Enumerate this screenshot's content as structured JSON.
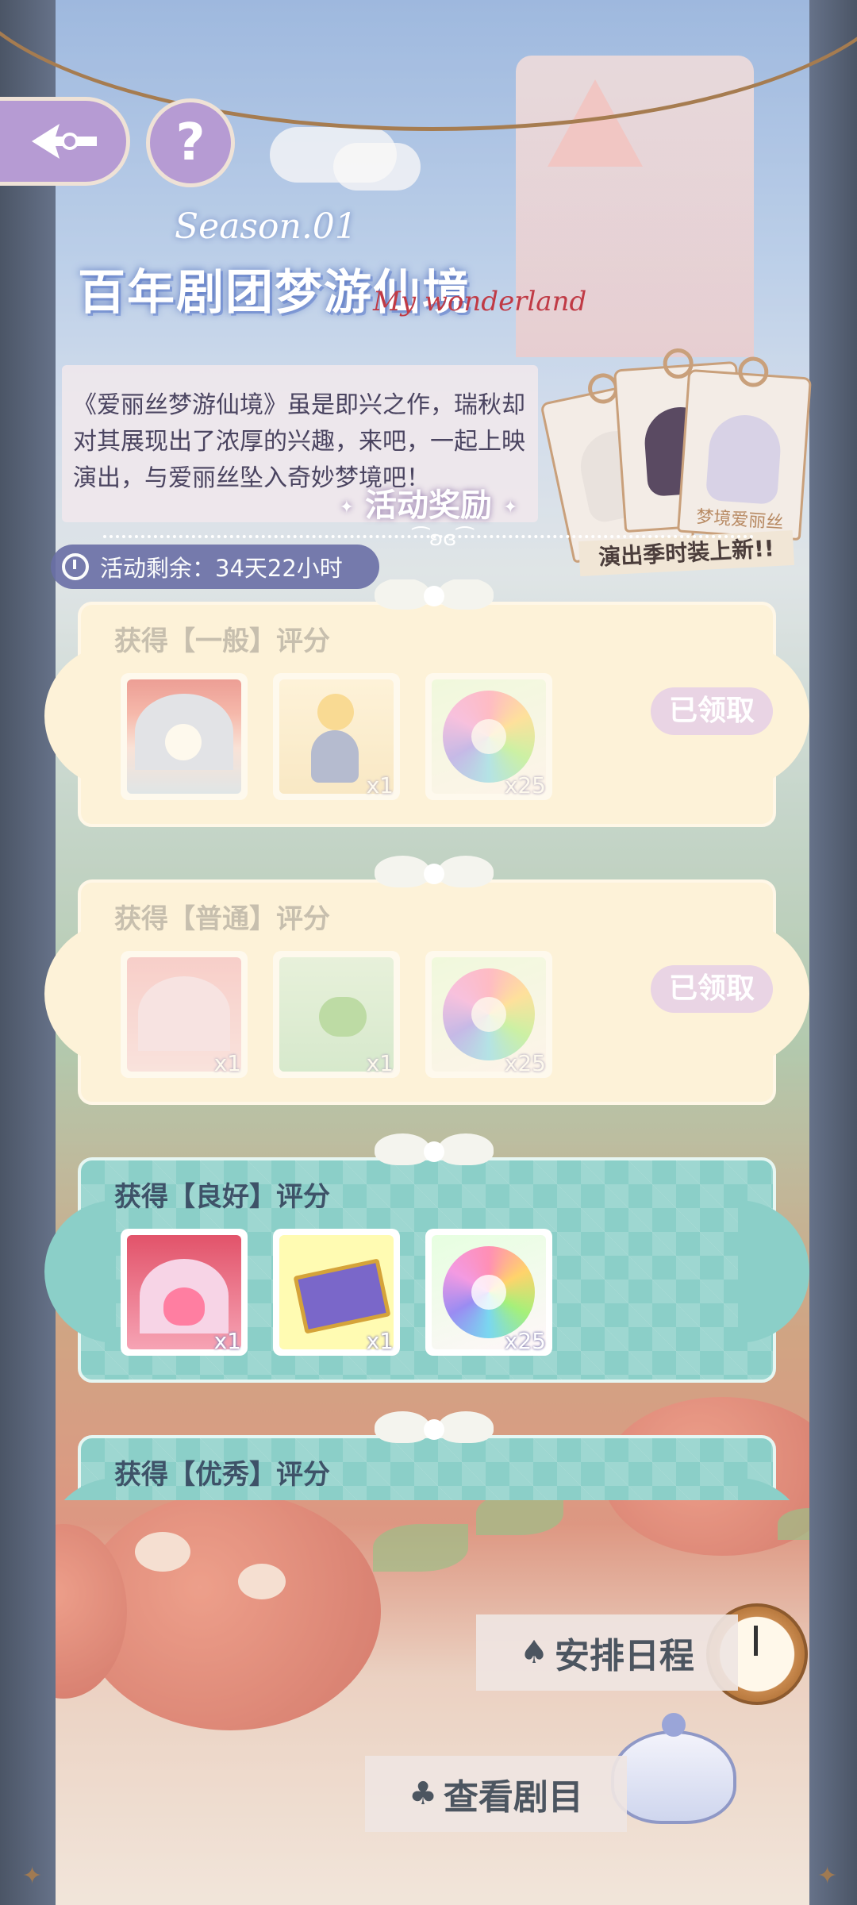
{
  "logo": {
    "season": "Season.01",
    "main": "百年剧团梦游仙境",
    "sub": "My wonderland"
  },
  "description": "《爱丽丝梦游仙境》虽是即兴之作，瑞秋却对其展现出了浓厚的兴趣，来吧，一起上映演出，与爱丽丝坠入奇妙梦境吧！",
  "promo": {
    "tag_name": "梦境爱丽丝",
    "label": "演出季时装上新!!"
  },
  "rewards_title": "活动奖励",
  "timer": "活动剩余：34天22小时",
  "rewards": [
    {
      "title": "获得【一般】评分",
      "state": "claimed",
      "button": "已领取",
      "items": [
        {
          "icon": "stage-background-icon",
          "qty": ""
        },
        {
          "icon": "alice-doll-icon",
          "qty": "x1"
        },
        {
          "icon": "rainbow-flower-icon",
          "qty": "x25"
        }
      ]
    },
    {
      "title": "获得【普通】评分",
      "state": "claimed",
      "button": "已领取",
      "items": [
        {
          "icon": "stage-background-icon",
          "qty": "x1"
        },
        {
          "icon": "garden-scene-icon",
          "qty": "x1"
        },
        {
          "icon": "rainbow-flower-icon",
          "qty": "x25"
        }
      ]
    },
    {
      "title": "获得【良好】评分",
      "state": "active",
      "button": "",
      "items": [
        {
          "icon": "heart-stage-icon",
          "qty": "x1"
        },
        {
          "icon": "magic-carpet-icon",
          "qty": "x1"
        },
        {
          "icon": "rainbow-flower-icon",
          "qty": "x25"
        }
      ]
    },
    {
      "title": "获得【优秀】评分",
      "state": "active",
      "button": "",
      "items": []
    }
  ],
  "actions": {
    "schedule": "安排日程",
    "schedule_suit": "♠",
    "view_play": "查看剧目",
    "view_play_suit": "♣"
  },
  "colors": {
    "claimed_card": "#fdf2d8",
    "active_card": "#8bcfc8",
    "button_purple": "#b69bd3",
    "claimed_button": "#e9d4e4"
  }
}
